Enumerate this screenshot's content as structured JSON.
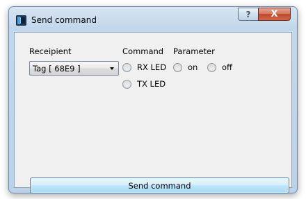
{
  "window": {
    "title": "Send command",
    "help_label": "?",
    "close_label": "X"
  },
  "form": {
    "recipient_label": "Receipient",
    "recipient_value": "Tag [ 68E9 ]",
    "command_label": "Command",
    "parameter_label": "Parameter",
    "commands": [
      {
        "label": "RX LED",
        "selected": false
      },
      {
        "label": "TX LED",
        "selected": false
      }
    ],
    "parameters": [
      {
        "label": "on",
        "selected": false
      },
      {
        "label": "off",
        "selected": false
      }
    ]
  },
  "actions": {
    "send_label": "Send command"
  }
}
